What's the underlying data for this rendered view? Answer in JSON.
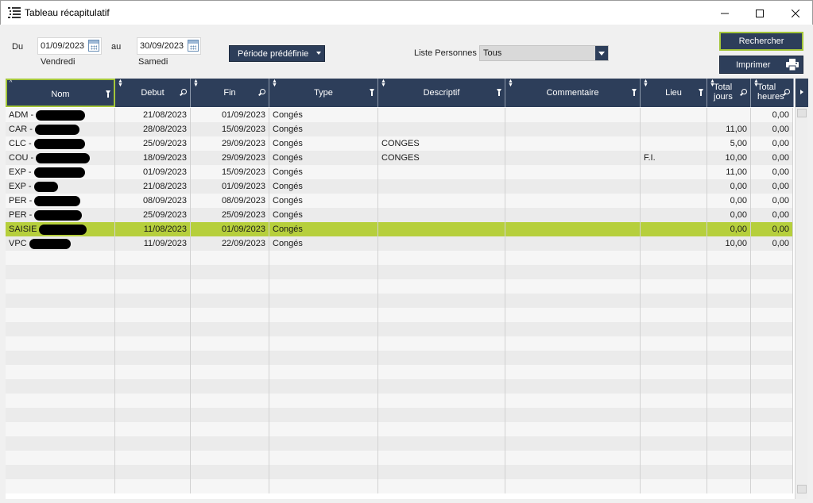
{
  "window": {
    "title": "Tableau récapitulatif"
  },
  "filters": {
    "du_label": "Du",
    "date_from": "01/09/2023",
    "date_from_day": "Vendredi",
    "au_label": "au",
    "date_to": "30/09/2023",
    "date_to_day": "Samedi",
    "period_button": "Période prédéfinie",
    "liste_label": "Liste Personnes",
    "liste_value": "Tous",
    "search_button": "Rechercher",
    "print_button": "Imprimer"
  },
  "table": {
    "columns": [
      "Nom",
      "Debut",
      "Fin",
      "Type",
      "Descriptif",
      "Commentaire",
      "Lieu",
      "Total jours",
      "Total heures"
    ],
    "rows": [
      {
        "nom": "ADM -",
        "redact": 62,
        "debut": "21/08/2023",
        "fin": "01/09/2023",
        "type": "Congés",
        "descriptif": "",
        "commentaire": "",
        "lieu": "",
        "jours": "",
        "heures": "0,00"
      },
      {
        "nom": "CAR -",
        "redact": 56,
        "debut": "28/08/2023",
        "fin": "15/09/2023",
        "type": "Congés",
        "descriptif": "",
        "commentaire": "",
        "lieu": "",
        "jours": "11,00",
        "heures": "0,00"
      },
      {
        "nom": "CLC -",
        "redact": 64,
        "debut": "25/09/2023",
        "fin": "29/09/2023",
        "type": "Congés",
        "descriptif": "CONGES",
        "commentaire": "",
        "lieu": "",
        "jours": "5,00",
        "heures": "0,00"
      },
      {
        "nom": "COU -",
        "redact": 68,
        "debut": "18/09/2023",
        "fin": "29/09/2023",
        "type": "Congés",
        "descriptif": "CONGES",
        "commentaire": "",
        "lieu": "F.I.",
        "jours": "10,00",
        "heures": "0,00"
      },
      {
        "nom": "EXP -",
        "redact": 64,
        "debut": "01/09/2023",
        "fin": "15/09/2023",
        "type": "Congés",
        "descriptif": "",
        "commentaire": "",
        "lieu": "",
        "jours": "11,00",
        "heures": "0,00"
      },
      {
        "nom": "EXP -",
        "redact": 30,
        "debut": "21/08/2023",
        "fin": "01/09/2023",
        "type": "Congés",
        "descriptif": "",
        "commentaire": "",
        "lieu": "",
        "jours": "0,00",
        "heures": "0,00"
      },
      {
        "nom": "PER -",
        "redact": 58,
        "debut": "08/09/2023",
        "fin": "08/09/2023",
        "type": "Congés",
        "descriptif": "",
        "commentaire": "",
        "lieu": "",
        "jours": "0,00",
        "heures": "0,00"
      },
      {
        "nom": "PER -",
        "redact": 60,
        "debut": "25/09/2023",
        "fin": "25/09/2023",
        "type": "Congés",
        "descriptif": "",
        "commentaire": "",
        "lieu": "",
        "jours": "0,00",
        "heures": "0,00"
      },
      {
        "nom": "SAISIE",
        "redact": 60,
        "debut": "11/08/2023",
        "fin": "01/09/2023",
        "type": "Congés",
        "descriptif": "",
        "commentaire": "",
        "lieu": "",
        "jours": "0,00",
        "heures": "0,00",
        "selected": true
      },
      {
        "nom": "VPC",
        "redact": 52,
        "debut": "11/09/2023",
        "fin": "22/09/2023",
        "type": "Congés",
        "descriptif": "",
        "commentaire": "",
        "lieu": "",
        "jours": "10,00",
        "heures": "0,00"
      }
    ]
  },
  "colors": {
    "header_bg": "#2d3e5a",
    "selection": "#b6cf3c",
    "accent_border": "#a4c63a"
  },
  "icons": [
    "list-icon",
    "calendar-icon",
    "dropdown-caret-icon",
    "printer-icon",
    "filter-icon",
    "magnifier-icon",
    "sort-arrows-icon"
  ]
}
